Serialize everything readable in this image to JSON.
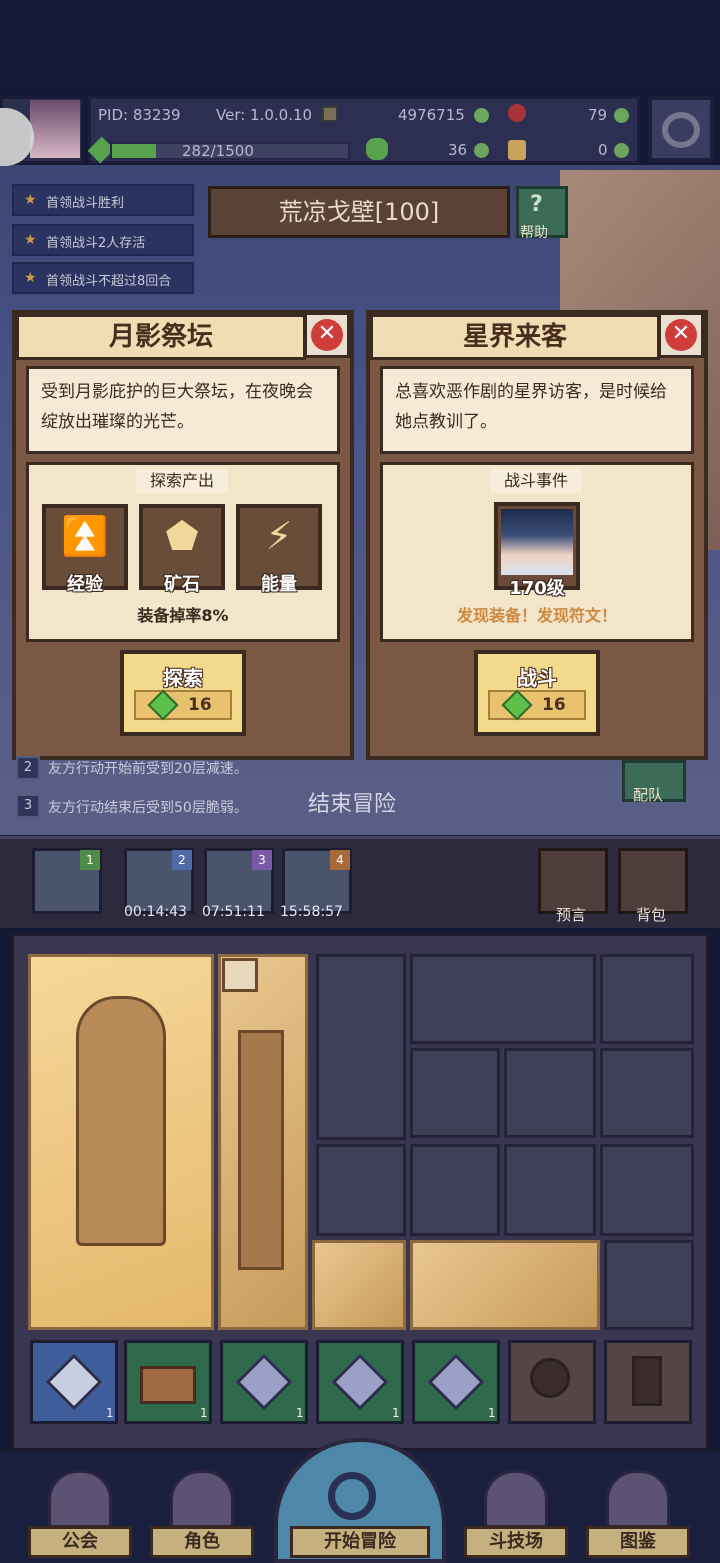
{
  "player": {
    "pid": "PID: 83239",
    "version": "Ver: 1.0.0.10",
    "gold": "4976715",
    "gems_red": "79",
    "exp": "282/1500",
    "exp_fraction": 0.188,
    "clover": "36",
    "potion": "0"
  },
  "objectives": [
    "首领战斗胜利",
    "首领战斗2人存活",
    "首领战斗不超过8回合"
  ],
  "stage": {
    "title": "荒凉戈壁[100]",
    "help_label": "帮助"
  },
  "card_left": {
    "title": "月影祭坛",
    "description": "受到月影庇护的巨大祭坛，在夜晚会绽放出璀璨的光芒。",
    "section": "探索产出",
    "outputs": [
      "经验",
      "矿石",
      "能量"
    ],
    "drop_rate": "装备掉率8%",
    "button": "探索",
    "cost": "16"
  },
  "card_right": {
    "title": "星界来客",
    "description": "总喜欢恶作剧的星界访客，是时候给她点教训了。",
    "section": "战斗事件",
    "enemy_level": "170级",
    "reward_text": "发现装备！发现符文！",
    "button": "战斗",
    "cost": "16"
  },
  "effects": {
    "line2_num": "2",
    "line2": "友方行动开始前受到20层减速。",
    "line3_num": "3",
    "line3": "友方行动结束后受到50层脆弱。"
  },
  "end_label": "结束冒险",
  "team_label": "配队",
  "slots": [
    {
      "num": "1",
      "timer": ""
    },
    {
      "num": "2",
      "timer": "00:14:43"
    },
    {
      "num": "3",
      "timer": "07:51:11"
    },
    {
      "num": "4",
      "timer": "15:58:57"
    }
  ],
  "side_buttons": [
    "预言",
    "背包"
  ],
  "items": [
    "1",
    "1",
    "1",
    "1",
    "1"
  ],
  "nav": [
    "公会",
    "角色",
    "开始冒险",
    "斗技场",
    "图鉴"
  ],
  "colors": {
    "background": "#131834",
    "card": "#7b5843",
    "close": "#cf3d3b",
    "gem": "#5cc04a",
    "reward": "#cc8a43"
  }
}
